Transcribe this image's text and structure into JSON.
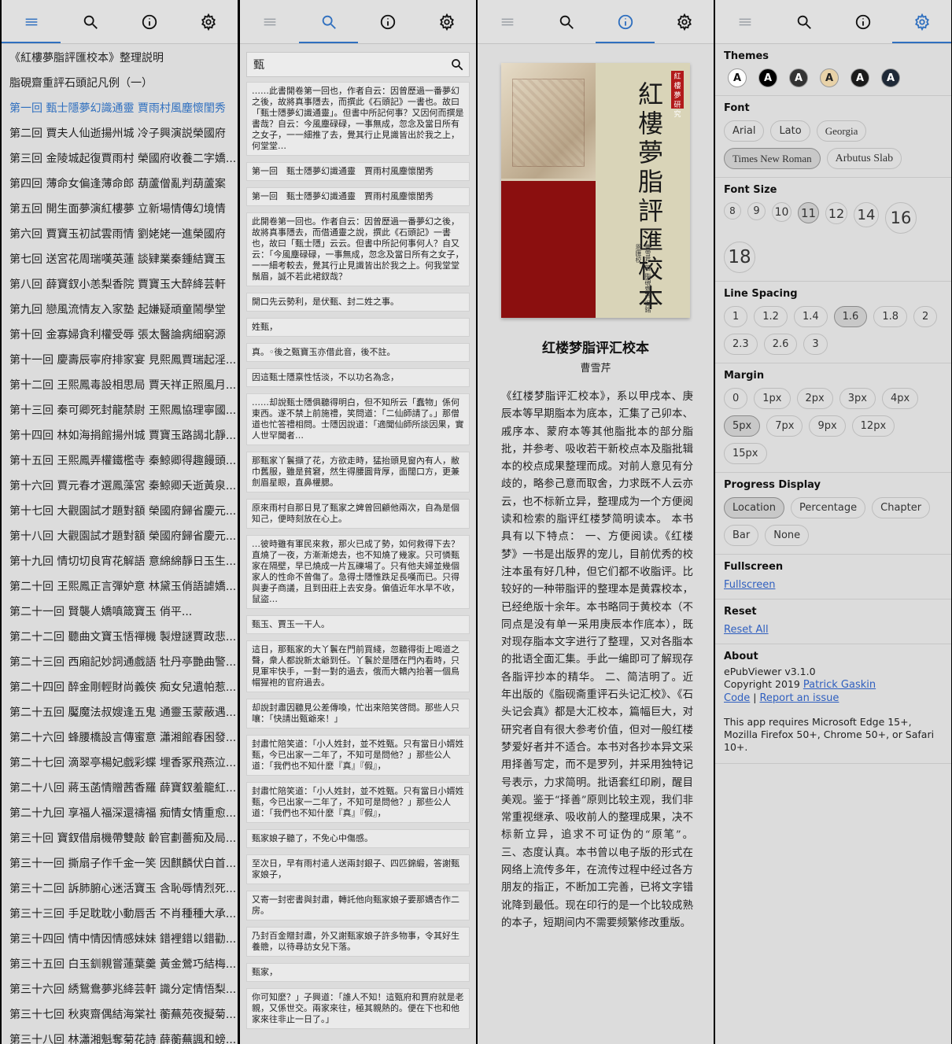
{
  "tabs": {
    "toc": "table-of-contents",
    "search": "search",
    "info": "info",
    "settings": "settings"
  },
  "toc": {
    "items": [
      "《紅樓夢脂評匯校本》整理説明",
      "脂硯齋重評石頭記凡例（一）",
      "第一回 甄士隱夢幻識通靈 賈雨村風塵懷閨秀",
      "第二回 賈夫人仙逝揚州城 冷子興演説榮國府",
      "第三回 金陵城起復賈雨村 榮國府收養二字嬌...",
      "第四回 薄命女偏逢薄命郎 葫蘆僧亂判葫蘆案",
      "第五回 開生面夢演紅樓夢 立新場情傳幻境情",
      "第六回 賈寶玉初試雲雨情 劉姥姥一進榮國府",
      "第七回 送宮花周瑞嘆英蓮 談肄業秦鍾結寶玉",
      "第八回 薛寶釵小恙梨香院 賈寶玉大醉絳芸軒",
      "第九回 戀風流情友入家塾 起嫌疑頑童鬧學堂",
      "第十回 金寡婦貪利權受辱 張太醫論病細窮源",
      "第十一回 慶壽辰寧府排家宴 見熙鳳賈瑞起淫...",
      "第十二回 王熙鳳毒設相思局 賈天祥正照風月...",
      "第十三回 秦可卿死封龍禁尉 王熙鳳協理寧國...",
      "第十四回 林如海捐館揚州城 賈寶玉路謁北靜...",
      "第十五回 王熙鳳弄權鐵檻寺 秦鯨卿得趣饅頭...",
      "第十六回 賈元春才選鳳藻宮 秦鯨卿夭逝黃泉...",
      "第十七回 大觀園試才題對額 榮國府歸省慶元...",
      "第十八回 大觀園試才題對額 榮國府歸省慶元...",
      "第十九回 情切切良宵花解語 意綿綿靜日玉生...",
      "第二十回 王熙鳳正言彈妒意 林黛玉俏語謔嬌...",
      "第二十一回 賢襲人嬌嗔箴寶玉 俏平...",
      "第二十二回 聽曲文寶玉悟禪機 製燈謎賈政悲...",
      "第二十三回 西廂記妙詞通戲語 牡丹亭艷曲警...",
      "第二十四回 醉金剛輕財尚義俠 痴女兒遺帕惹...",
      "第二十五回 魘魔法叔嫂逢五鬼 通靈玉蒙蔽遇...",
      "第二十六回 蜂腰橋設言傳蜜意 瀟湘館春困發...",
      "第二十七回 滴翠亭楊妃戲彩蝶 埋香冢飛燕泣...",
      "第二十八回 蔣玉菡情贈茜香羅 薛寶釵羞籠紅...",
      "第二十九回 享福人福深還禱福 痴情女情重愈...",
      "第三十回 寶釵借扇機帶雙敲 齡官劃薔痴及局...",
      "第三十一回 撕扇子作千金一笑 因麒麟伏白首...",
      "第三十二回 訴肺腑心迷活寶玉 含恥辱情烈死...",
      "第三十三回 手足耽耽小動唇舌 不肖種種大承...",
      "第三十四回 情中情因情感妹妹 錯裡錯以錯勸...",
      "第三十五回 白玉釧親嘗蓮葉羹 黃金鶯巧結梅...",
      "第三十六回 綉鴛鴦夢兆絳芸軒 識分定情悟梨...",
      "第三十七回 秋爽齋偶結海棠社 蘅蕪苑夜擬菊...",
      "第三十八回 林瀟湘魁奪菊花詩 薛蘅蕪諷和螃..."
    ]
  },
  "search": {
    "query": "甄",
    "results": [
      "……此書開卷第一回也，作者自云：因曾歷過一番夢幻之後，故將真事隱去，而撰此《石頭記》一書也。故曰「甄士隱夢幻識通靈」。但書中所記何事？又因何而撰是書哉？自云：今風塵碌碌，一事無成，忽念及當日所有之女子，一一細推了去，覺其行止見識皆出於我之上，何堂堂…",
      "第一回　甄士隱夢幻識通靈　賈雨村風塵懷閨秀",
      "第一回　甄士隱夢幻識通靈　賈雨村風塵懷閨秀",
      "此開卷第一回也。作者自云：因曾歷過一番夢幻之後，故將真事隱去，而借通靈之說，撰此《石頭記》一書也，故曰「甄士隱」云云。但書中所記何事何人？自又云：「今風塵碌碌，一事無成，忽念及當日所有之女子，一一細考較去，覺其行止見識皆出於我之上。何我堂堂鬚眉，誠不若此裙釵哉？",
      "開口先云勢利，是伏甄、封二姓之事。",
      "姓甄，",
      "真。◦後之甄寶玉亦借此音，後不註。",
      "因這甄士隱禀性恬淡，不以功名為念，",
      "……却說甄士隱俱聽得明白，但不知所云「蠢物」係何東西。遂不禁上前施禮，笑問道：「二仙師請了。」那僧道也忙答禮相問。士隱因說道：「適聞仙師所談因果，實人世罕聞者…",
      "那甄家丫鬟擷了花，方欲走時，猛抬頭見窗內有人，敝巾舊服，雖是貧窘，然生得腰圓背厚，面闊口方，更兼劍眉星眼，直鼻權腮。",
      "原來雨村自那日見了甄家之婢曾回顧他兩次，自為是個知己，便時刻放在心上。",
      "…彼時雖有軍民來救，那火已成了勢，如何救得下去？直燒了一夜，方漸漸熄去，也不知燒了幾家。只可憐甄家在隔壁，早已燒成一片瓦礫場了。只有他夫婦並幾個家人的性命不曾傷了。急得士隱惟跌足長嘆而已。只得與妻子商議，且到田莊上去安身。偏值近年水旱不收，鼠盜…",
      "甄玉、賈玉一干人。",
      "這日，那甄家的大丫鬟在門前買綫，忽聽得街上喝道之聲，衆人都說新太爺到任。丫鬟於是隱在門內看時，只見軍牢快手，一對一對的過去，俄而大轎內抬著一個鳥帽猩袍的官府過去。",
      "却說封肅因聽見公差傳喚，忙出來陪笑啓問。那些人只嚷：「快請出甄爺來！」",
      "封肅忙陪笑道：「小人姓封，並不姓甄。只有當日小婿姓甄，今已出家一二年了，不知可是問他？」那些公人道：「我們也不知什麼『真』『假』，",
      "封肅忙陪笑道：「小人姓封，並不姓甄。只有當日小婿姓甄，今已出家一二年了，不知可是問他？」那些公人道：「我們也不知什麼『真』『假』，",
      "甄家娘子聽了，不免心中傷感。",
      "至次日，早有雨村遣人送兩封銀子、四匹錦緞，答謝甄家娘子，",
      "又寄一封密書與封肅，轉託他向甄家娘子要那嬌杏作二房。",
      "乃封百金贈封肅，外又謝甄家娘子許多物事，令其好生養贍，以待尋訪女兒下落。",
      "甄家，",
      "你可知麼？」子興道：「誰人不知！這甄府和賈府就是老親，又係世交。兩家來往，極其親熱的。便在下也和他家來往非止一日了。」"
    ]
  },
  "info": {
    "cover_title": "紅樓夢脂評匯校本",
    "cover_seal": "紅樓夢研究",
    "cover_authors": "曹雪芹 著 脂硯齋評 吳銘恩匯校",
    "book_title": "红楼梦脂评汇校本",
    "book_author": "曹雪芹",
    "description": "《红楼梦脂评汇校本》，系以甲戌本、庚辰本等早期脂本为底本，汇集了己卯本、戚序本、蒙府本等其他脂批本的部分脂批，并参考、吸收若干新校点本及脂批辑本的校点成果整理而成。对前人意见有分歧的，略参己意而取舍，力求既不人云亦云，也不标新立异，整理成为一个方便阅读和检索的脂评红楼梦简明读本。 本书具有以下特点： 一、方便阅读。《红楼梦》一书是出版界的宠儿，目前优秀的校注本虽有好几种，但它们都不收脂评。比较好的一种带脂评的整理本是黄霖校本，已经绝版十余年。本书略同于黄校本（不同点是没有单一采用庚辰本作底本），既对现存脂本文字进行了整理，又对各脂本的批语全面汇集。手此一编即可了解现存各脂评抄本的精华。 二、简洁明了。近年出版的《脂砚斋重评石头记汇校》、《石头记会真》都是大汇校本，篇幅巨大，对研究者自有很大参考价值，但对一般红楼梦爱好者并不适合。本书对各抄本异文采用择善写定，而不是罗列，并采用独特记号表示，力求简明。批语套红印刷，醒目美观。鉴于“择善”原则比较主观，我们非常重视继承、吸收前人的整理成果，决不标新立异，追求不可证伪的“原笔”。 三、态度认真。本书曾以电子版的形式在网络上流传多年，在流传过程中经过各方朋友的指正，不断加工完善，已将文字错讹降到最低。现在印行的是一个比较成熟的本子，短期间内不需要频繁修改重版。"
  },
  "settings": {
    "themes_title": "Themes",
    "themes": [
      {
        "label": "A",
        "bg": "#ffffff",
        "fg": "#111111"
      },
      {
        "label": "A",
        "bg": "#000000",
        "fg": "#ffffff"
      },
      {
        "label": "A",
        "bg": "#333333",
        "fg": "#ffffff"
      },
      {
        "label": "A",
        "bg": "#e8d2a8",
        "fg": "#222222"
      },
      {
        "label": "A",
        "bg": "#1a1a1a",
        "fg": "#ffffff"
      },
      {
        "label": "A",
        "bg": "#1f2937",
        "fg": "#ffffff"
      }
    ],
    "font_title": "Font",
    "fonts": [
      "Arial",
      "Lato",
      "Georgia",
      "Times New Roman",
      "Arbutus Slab"
    ],
    "font_selected": "Times New Roman",
    "fontsize_title": "Font Size",
    "fontsizes": [
      "8",
      "9",
      "10",
      "11",
      "12",
      "14",
      "16",
      "18"
    ],
    "fontsize_selected": "11",
    "linespacing_title": "Line Spacing",
    "linespacings": [
      "1",
      "1.2",
      "1.4",
      "1.6",
      "1.8",
      "2",
      "2.3",
      "2.6",
      "3"
    ],
    "linespacing_selected": "1.6",
    "margin_title": "Margin",
    "margins": [
      "0",
      "1px",
      "2px",
      "3px",
      "4px",
      "5px",
      "7px",
      "9px",
      "12px",
      "15px"
    ],
    "margin_selected": "5px",
    "progress_title": "Progress Display",
    "progress_options": [
      "Location",
      "Percentage",
      "Chapter",
      "Bar",
      "None"
    ],
    "progress_selected": "Location",
    "fullscreen_title": "Fullscreen",
    "fullscreen_link": "Fullscreen",
    "reset_title": "Reset",
    "reset_link": "Reset All",
    "about_title": "About",
    "about_version": "ePubViewer v3.1.0",
    "about_copyright": "Copyright 2019 ",
    "about_author": "Patrick Gaskin",
    "about_code": "Code",
    "about_sep": " | ",
    "about_issue": "Report an issue",
    "about_requires": "This app requires Microsoft Edge 15+, Mozilla Firefox 50+, Chrome 50+, or Safari 10+."
  }
}
